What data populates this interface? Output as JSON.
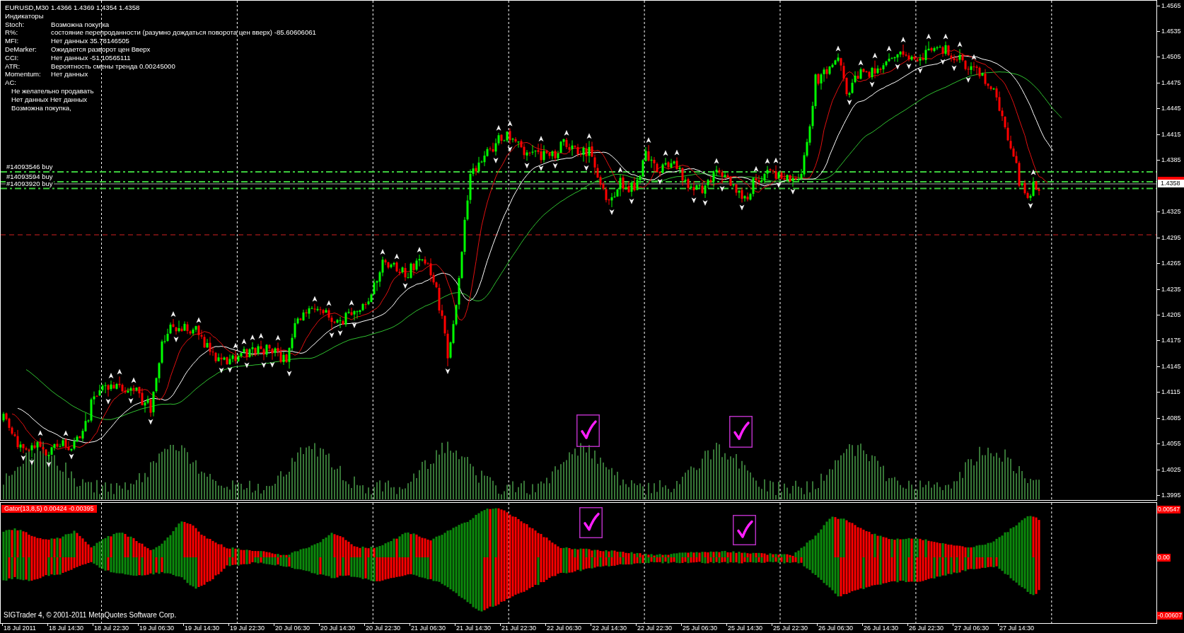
{
  "chart_header": {
    "symbol": "EURUSD,M30",
    "quotes": "1.4366 1.4369 1.4354 1.4358",
    "title": "Индикаторы"
  },
  "indicators": [
    {
      "name": "Stoch:",
      "value": "Возможна покупка"
    },
    {
      "name": "R%:",
      "value": "состояние перепроданности (разумно дождаться поворота цен вверх) -85.60606061"
    },
    {
      "name": "MFI:",
      "value": "Нет данных 35.78146505"
    },
    {
      "name": "DeMarker:",
      "value": "Ожидается разворот цен Вверх"
    },
    {
      "name": "CCI:",
      "value": "Нет данных -51.10565111"
    },
    {
      "name": "ATR:",
      "value": "Вероятность смены тренда 0.00245000"
    },
    {
      "name": "Momentum:",
      "value": "Нет данных"
    },
    {
      "name": "AC:"
    }
  ],
  "ac_notes": [
    "Не желательно продавать",
    "Нет данных Нет данных",
    "Возможна покупка,"
  ],
  "orders": [
    {
      "label": "#14093546 buy"
    },
    {
      "label": "#14093594 buy"
    },
    {
      "label": "#14093920 buy"
    }
  ],
  "price_axis": {
    "labels": [
      "1.4565",
      "1.4535",
      "1.4505",
      "1.4475",
      "1.4445",
      "1.4415",
      "1.4385",
      "1.4325",
      "1.4295",
      "1.4265",
      "1.4235",
      "1.4205",
      "1.4175",
      "1.4145",
      "1.4115",
      "1.4085",
      "1.4055",
      "1.4025",
      "1.3995"
    ],
    "current_price": "1.4358"
  },
  "indicator_pane": {
    "label": "Gator(13,8,5) 0.00424 -0.00395",
    "copyright": "SIGTrader 4, © 2001-2011 MetaQuotes Software Corp.",
    "axis_labels": [
      "0.00547",
      "0.00",
      "-0.00607"
    ]
  },
  "time_axis": {
    "labels": [
      "18 Jul 2011",
      "18 Jul 14:30",
      "18 Jul 22:30",
      "19 Jul 06:30",
      "19 Jul 14:30",
      "19 Jul 22:30",
      "20 Jul 06:30",
      "20 Jul 14:30",
      "20 Jul 22:30",
      "21 Jul 06:30",
      "21 Jul 14:30",
      "21 Jul 22:30",
      "22 Jul 06:30",
      "22 Jul 14:30",
      "22 Jul 22:30",
      "25 Jul 06:30",
      "25 Jul 14:30",
      "25 Jul 22:30",
      "26 Jul 06:30",
      "26 Jul 14:30",
      "26 Jul 22:30",
      "27 Jul 06:30",
      "27 Jul 14:30"
    ]
  }
}
